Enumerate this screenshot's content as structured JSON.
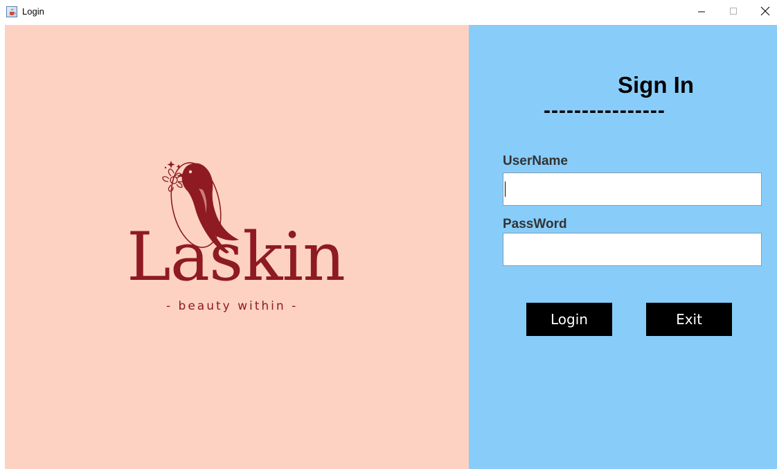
{
  "window": {
    "title": "Login",
    "app_icon": "java-cup-icon",
    "controls": {
      "minimize": "minimize-icon",
      "maximize": "maximize-icon",
      "close": "close-icon"
    }
  },
  "branding": {
    "name": "Laskin",
    "tagline": "- beauty within -",
    "logo_icon": "bird-flower-emblem",
    "panel_color": "#fdd2c2",
    "brand_color": "#8e1a22"
  },
  "login_form": {
    "title": "Sign In",
    "divider": "----------------",
    "username_label": "UserName",
    "username_value": "",
    "password_label": "PassWord",
    "password_value": "",
    "panel_color": "#88cdf9"
  },
  "actions": {
    "login_label": "Login",
    "exit_label": "Exit"
  }
}
